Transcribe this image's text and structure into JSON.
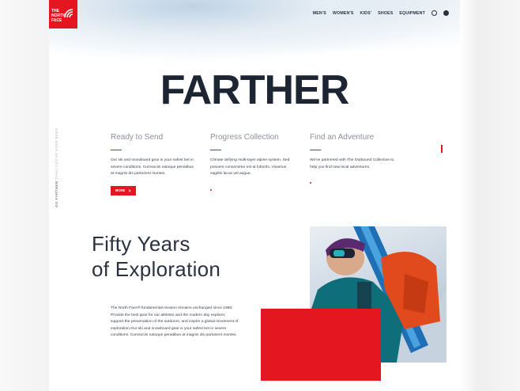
{
  "brand": {
    "logo_text": "THE NORTH FACE",
    "logo_line1": "THE",
    "logo_line2": "NORTH",
    "logo_line3": "FACE",
    "accent_color": "#e4161f"
  },
  "nav": {
    "items": [
      {
        "label": "MEN'S"
      },
      {
        "label": "WOMEN'S"
      },
      {
        "label": "KIDS'"
      },
      {
        "label": "SHOES"
      },
      {
        "label": "EQUIPMENT"
      }
    ],
    "icons": [
      "search-icon",
      "user-icon"
    ]
  },
  "hero": {
    "title": "FARTHER"
  },
  "side": {
    "vertical_label_bold": "GO FARTHER",
    "vertical_label": "THAN YOU'VE EVER BEEN"
  },
  "columns": [
    {
      "title": "Ready to Send",
      "text": "Our ski and snowboard gear is your safest bet in severe conditions. Cumsociis natoque penatibus at magnis dis parturient montes.",
      "button_label": "MORE"
    },
    {
      "title": "Progress Collection",
      "text": "Climate defying multi-layer alpine system. Sed posuere consectetur est at lobortis. Vivamus sagittis lacus vel augue."
    },
    {
      "title": "Find an Adventure",
      "text": "We've partnered with The Outbound Collective to help you find new local adventures."
    }
  ],
  "section": {
    "title_line1": "Fifty Years",
    "title_line2": "of Exploration",
    "body": "The North Face® fundamental mission remains unchanged since 1966: Provide the best gear for our athletes and the modern day explorer, support the preservation of the outdoors, and inspire a global movement of exploration.Our ski and snowboard gear is your safest bet in severe conditions. Cumsociis natoque penatibus at magnis dis parturient montes."
  }
}
